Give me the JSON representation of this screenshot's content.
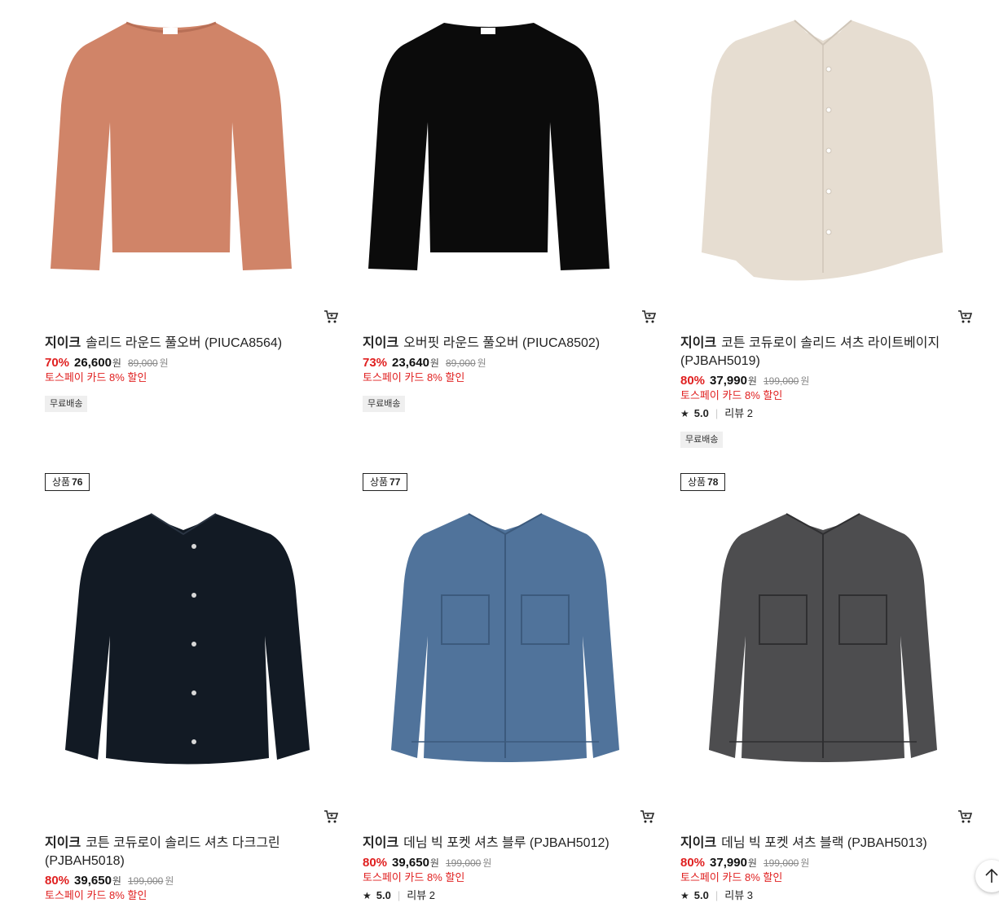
{
  "products": [
    {
      "brand": "지이크",
      "name": "솔리드 라운드 풀오버 (PIUCA8564)",
      "discount": "70%",
      "price": "26,600",
      "currency": "원",
      "original": "89,000",
      "promo": "토스페이 카드 8% 할인",
      "badge": "무료배송",
      "color": "#d08468"
    },
    {
      "brand": "지이크",
      "name": "오버핏 라운드 풀오버 (PIUCA8502)",
      "discount": "73%",
      "price": "23,640",
      "currency": "원",
      "original": "89,000",
      "promo": "토스페이 카드 8% 할인",
      "badge": "무료배송",
      "color": "#0b0b0b"
    },
    {
      "brand": "지이크",
      "name": "코튼 코듀로이 솔리드 셔츠 라이트베이지 (PJBAH5019)",
      "discount": "80%",
      "price": "37,990",
      "currency": "원",
      "original": "199,000",
      "promo": "토스페이 카드 8% 할인",
      "rating": "5.0",
      "review_label": "리뷰",
      "review_count": "2",
      "badge": "무료배송",
      "color": "#e6ddd1"
    },
    {
      "rank_label": "상품",
      "rank": "76",
      "brand": "지이크",
      "name": "코튼 코듀로이 솔리드 셔츠 다크그린 (PJBAH5018)",
      "discount": "80%",
      "price": "39,650",
      "currency": "원",
      "original": "199,000",
      "promo": "토스페이 카드 8% 할인",
      "color": "#121a24"
    },
    {
      "rank_label": "상품",
      "rank": "77",
      "brand": "지이크",
      "name": "데님 빅 포켓 셔츠 블루 (PJBAH5012)",
      "discount": "80%",
      "price": "39,650",
      "currency": "원",
      "original": "199,000",
      "promo": "토스페이 카드 8% 할인",
      "rating": "5.0",
      "review_label": "리뷰",
      "review_count": "2",
      "color": "#50739b"
    },
    {
      "rank_label": "상품",
      "rank": "78",
      "brand": "지이크",
      "name": "데님 빅 포켓 셔츠 블랙 (PJBAH5013)",
      "discount": "80%",
      "price": "37,990",
      "currency": "원",
      "original": "199,000",
      "promo": "토스페이 카드 8% 할인",
      "rating": "5.0",
      "review_label": "리뷰",
      "review_count": "3",
      "color": "#4d4d4f"
    }
  ],
  "icons": {
    "cart": "cart-icon",
    "star": "star-icon",
    "scroll_top": "arrow-up-icon"
  }
}
